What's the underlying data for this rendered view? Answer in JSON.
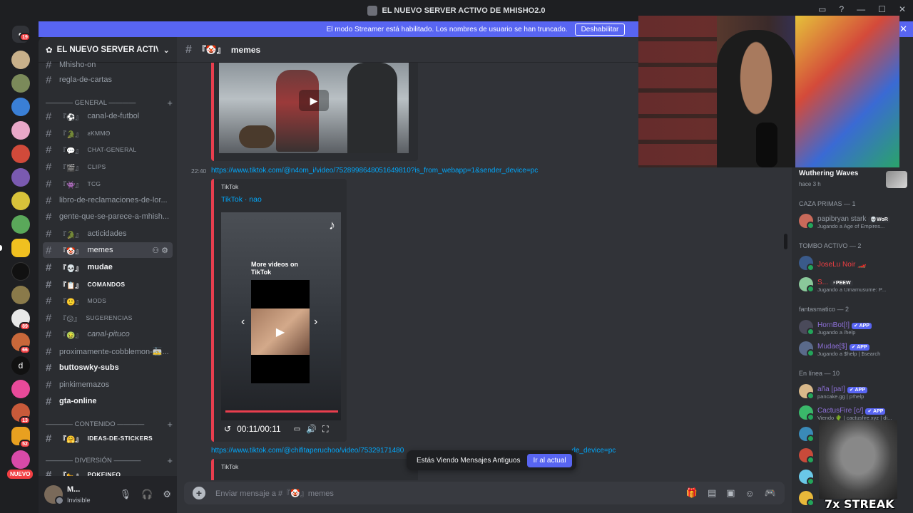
{
  "window": {
    "title": "EL NUEVO SERVER ACTIVO DE MHISHO2.0"
  },
  "streamer_banner": {
    "text": "El modo Streamer está habilitado. Los nombres de usuario se han truncado.",
    "button": "Deshabilitar"
  },
  "rail": {
    "dm_badge": "19",
    "badges": [
      "89",
      "66",
      "13",
      "52"
    ],
    "nuevo": "NUEVO"
  },
  "guild": {
    "name": "EL NUEVO SERVER ACTIVO ..."
  },
  "channels_top": [
    {
      "name": "Mhisho-on",
      "emoji": ""
    },
    {
      "name": "regla-de-cartas",
      "emoji": ""
    }
  ],
  "categories": {
    "general": "———— GENERAL ————",
    "contenido": "———— CONTENIDO ————",
    "diversion": "———— DIVERSIÓN ————"
  },
  "channels_general": [
    {
      "name": "canal-de-futbol",
      "emoji": "『⚽』"
    },
    {
      "name": "ƨKMMΘ",
      "emoji": "『🐊』"
    },
    {
      "name": "CHAT-GENERAL",
      "emoji": "『💬』"
    },
    {
      "name": "CLIPS",
      "emoji": "『🎬』"
    },
    {
      "name": "TCG",
      "emoji": "『👾』"
    },
    {
      "name": "libro-de-reclamaciones-de-lor...",
      "emoji": ""
    },
    {
      "name": "gente-que-se-parece-a-mhish...",
      "emoji": ""
    },
    {
      "name": "acticidades",
      "emoji": "『🐊』"
    },
    {
      "name": "memes",
      "emoji": "『🤡』"
    },
    {
      "name": "mudae",
      "emoji": "『💀』"
    },
    {
      "name": "COMANDOS",
      "emoji": "『📋』"
    },
    {
      "name": "MODS",
      "emoji": "『🙂』"
    },
    {
      "name": "SUGERENCIAS",
      "emoji": "『😕』"
    },
    {
      "name": "canal-pituco",
      "emoji": "『🤢』"
    },
    {
      "name": "proximamente-cobblemon-🚋...",
      "emoji": ""
    },
    {
      "name": "buttoswky-subs",
      "emoji": ""
    },
    {
      "name": "pinkimemazos",
      "emoji": ""
    },
    {
      "name": "gta-online",
      "emoji": ""
    }
  ],
  "channels_contenido": [
    {
      "name": "IDEAS-DE-STICKERS",
      "emoji": "『🤗』"
    }
  ],
  "channels_diversion": [
    {
      "name": "POKEINFO",
      "emoji": "『🐆』"
    }
  ],
  "user": {
    "name": "M...",
    "status": "Invisible"
  },
  "chat": {
    "channel_name": "memes",
    "channel_emoji": "『🤡』",
    "time1": "22:40",
    "link1": "https://www.tiktok.com/@n4om_i/video/7528998648051649810?is_from_webapp=1&sender_device=pc",
    "embed_provider": "TikTok",
    "embed_title": "TikTok · nao",
    "tiktok_more": "More videos on TikTok",
    "video_time": "00:11/00:11",
    "link2": "https://www.tiktok.com/@chifitaperuchoo/video/75329171480",
    "link2_tail": "de_device=pc",
    "embed3_provider": "TikTok",
    "old_messages": "Estás Viendo Mensajes Antiguos",
    "go_current": "Ir al actual",
    "composer_placeholder": "Enviar mensaje a #『🤡』memes"
  },
  "members": {
    "activity_title": "Wuthering Waves",
    "activity_time": "hace 3 h",
    "cat1": "CAZA PRIMAS — 1",
    "cat2": "TOMBO ACTIVO — 2",
    "cat3": "fantasmatico — 2",
    "cat4": "En línea — 10",
    "list": [
      {
        "name": "papibryan stark",
        "tag": "💀WoR",
        "status": "Jugando a Age of Empires...",
        "color": "#949ba4",
        "app": ""
      },
      {
        "name": "JoseLu Noir 🏎️",
        "tag": "",
        "status": "",
        "color": "#f23f43",
        "app": ""
      },
      {
        "name": "S...",
        "tag": "⚡PEEW",
        "status": "Jugando a Umamusume: P...",
        "color": "#f23f43",
        "app": ""
      },
      {
        "name": "HornBot[!]",
        "tag": "",
        "status": "Jugando a /help",
        "color": "#8c6fd6",
        "app": "✔ APP"
      },
      {
        "name": "Mudae[$]",
        "tag": "",
        "status": "Jugando a $help | $search",
        "color": "#8c6fd6",
        "app": "✔ APP"
      },
      {
        "name": "aña [pa!]",
        "tag": "",
        "status": "pancake.gg | p!help",
        "color": "#8c6fd6",
        "app": "✔ APP"
      },
      {
        "name": "CactusFire [c/]",
        "tag": "",
        "status": "Viendo 🌵 | cactusfire.xyz | di...",
        "color": "#8c6fd6",
        "app": "✔ APP"
      }
    ]
  },
  "overlay": {
    "streak": "7x STREAK"
  },
  "colors": {
    "accent": "#5865f2",
    "link": "#00a8fc",
    "embed_border": "#e83e4e",
    "online": "#23a55a"
  }
}
